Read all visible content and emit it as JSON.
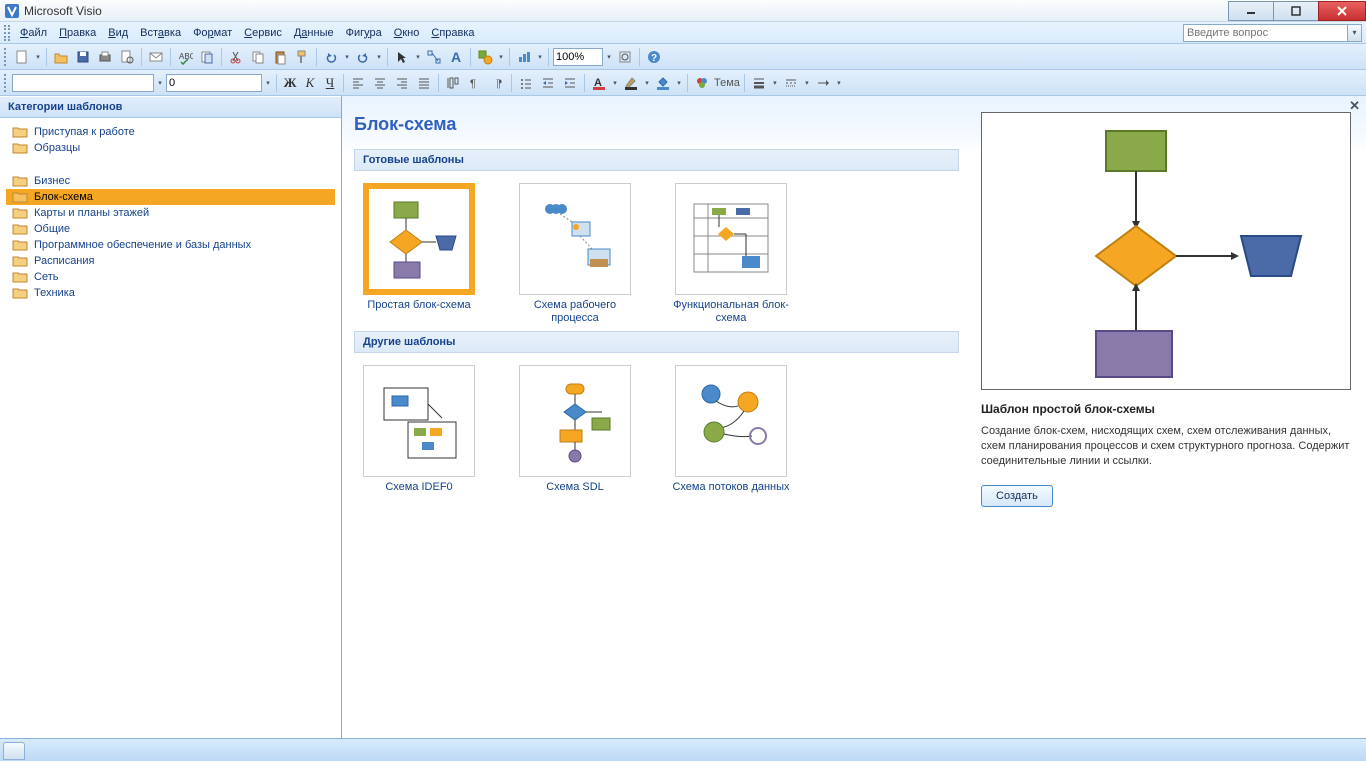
{
  "app": {
    "title": "Microsoft Visio"
  },
  "menu": {
    "items": [
      "Файл",
      "Правка",
      "Вид",
      "Вставка",
      "Формат",
      "Сервис",
      "Данные",
      "Фигура",
      "Окно",
      "Справка"
    ],
    "help_placeholder": "Введите вопрос"
  },
  "toolbar": {
    "zoom": "100%"
  },
  "format_bar": {
    "font": "",
    "size": "0",
    "theme_label": "Тема"
  },
  "sidebar": {
    "header": "Категории шаблонов",
    "group1": [
      "Приступая к работе",
      "Образцы"
    ],
    "group2": [
      "Бизнес",
      "Блок-схема",
      "Карты и планы этажей",
      "Общие",
      "Программное обеспечение и базы данных",
      "Расписания",
      "Сеть",
      "Техника"
    ],
    "selected": "Блок-схема"
  },
  "content": {
    "title": "Блок-схема",
    "section1": "Готовые шаблоны",
    "templates1": [
      {
        "label": "Простая блок-схема",
        "selected": true
      },
      {
        "label": "Схема рабочего процесса",
        "selected": false
      },
      {
        "label": "Функциональная блок-схема",
        "selected": false
      }
    ],
    "section2": "Другие шаблоны",
    "templates2": [
      {
        "label": "Схема IDEF0"
      },
      {
        "label": "Схема SDL"
      },
      {
        "label": "Схема потоков данных"
      }
    ]
  },
  "preview": {
    "title": "Шаблон простой блок-схемы",
    "desc": "Создание блок-схем, нисходящих схем, схем отслеживания данных, схем планирования процессов и схем структурного прогноза. Содержит соединительные линии и ссылки.",
    "button": "Создать"
  }
}
